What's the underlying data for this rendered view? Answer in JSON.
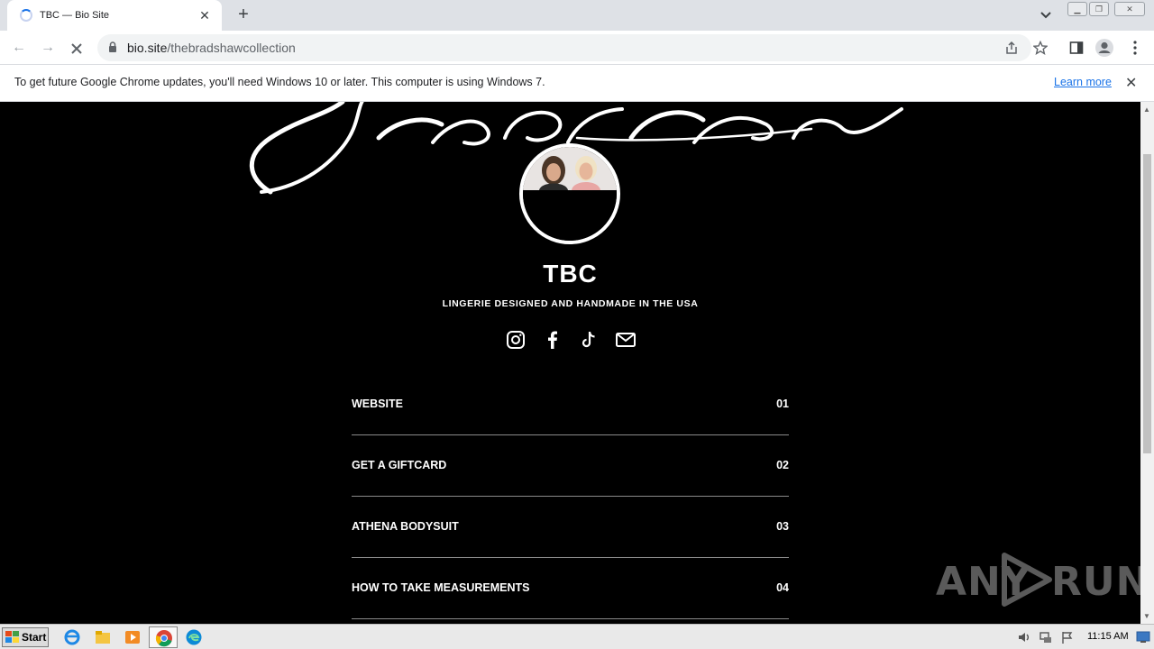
{
  "browser": {
    "tab_title": "TBC — Bio Site",
    "url_host": "bio.site",
    "url_path": "/thebradshawcollection"
  },
  "infobar": {
    "message": "To get future Google Chrome updates, you'll need Windows 10 or later. This computer is using Windows 7.",
    "learn_more": "Learn more"
  },
  "profile": {
    "logo_script": "Bradshaw",
    "brand": "TBC",
    "tagline": "LINGERIE DESIGNED AND HANDMADE IN THE USA",
    "socials": [
      "instagram-icon",
      "facebook-icon",
      "tiktok-icon",
      "email-icon"
    ]
  },
  "links": [
    {
      "label": "WEBSITE",
      "num": "01"
    },
    {
      "label": "GET A GIFTCARD",
      "num": "02"
    },
    {
      "label": "ATHENA BODYSUIT",
      "num": "03"
    },
    {
      "label": "HOW TO TAKE MEASUREMENTS",
      "num": "04"
    }
  ],
  "watermark": {
    "left": "ANY",
    "right": "RUN"
  },
  "taskbar": {
    "start": "Start",
    "clock": "11:15 AM"
  },
  "colors": {
    "page_bg": "#000000",
    "text": "#ffffff",
    "link_accent": "#1a73e8"
  }
}
